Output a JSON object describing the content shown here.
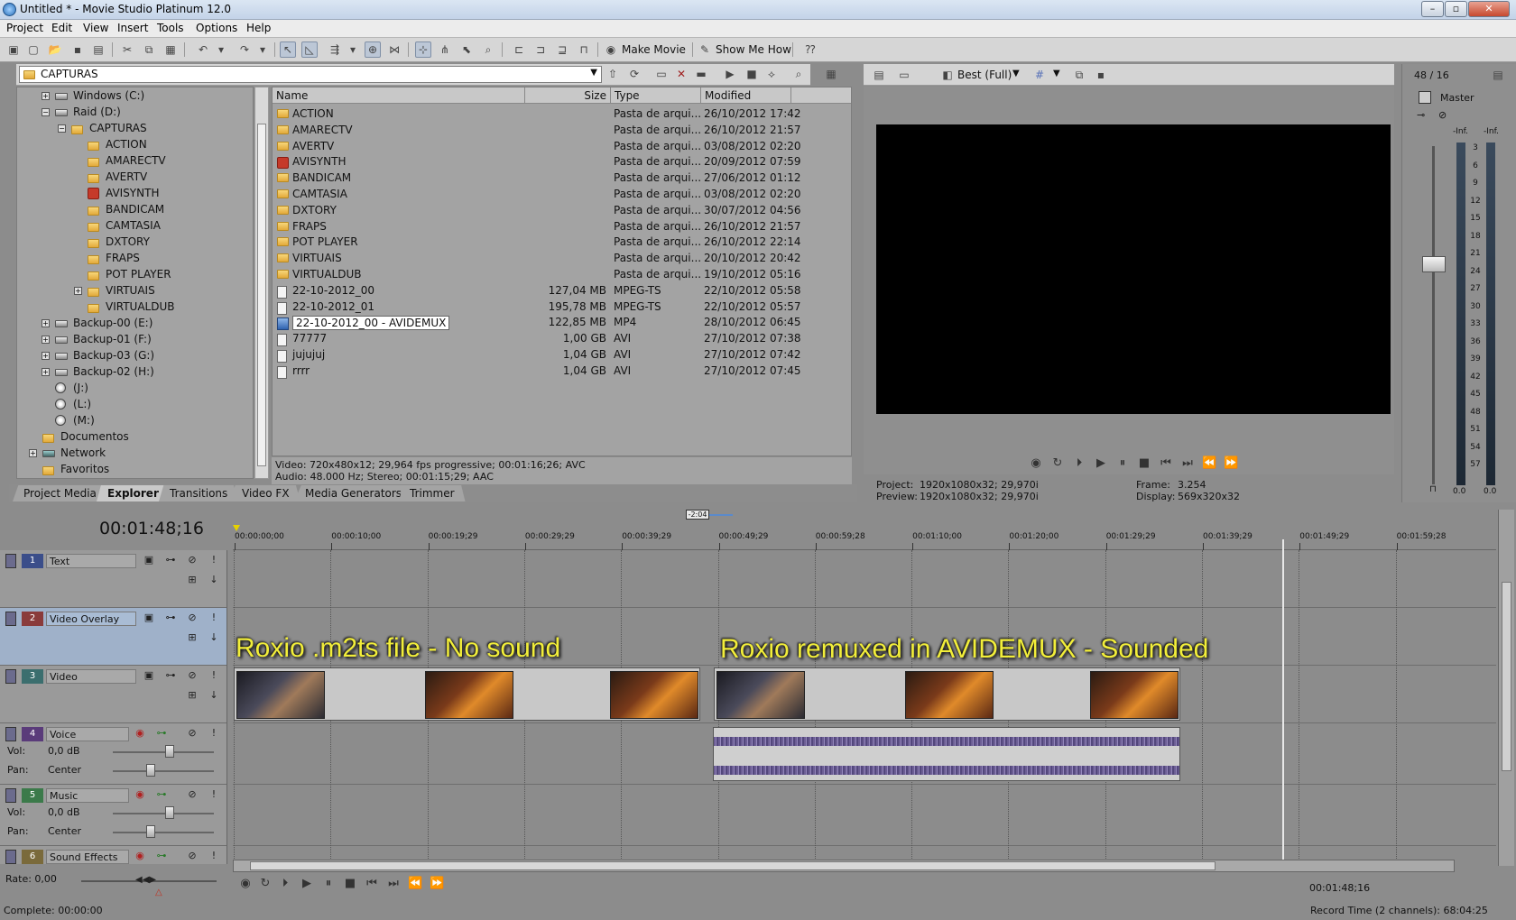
{
  "window": {
    "title": "Untitled * - Movie Studio Platinum 12.0",
    "controls": [
      "–",
      "▫",
      "✕"
    ]
  },
  "menu": [
    "Project",
    "Edit",
    "View",
    "Insert",
    "Tools",
    "Options",
    "Help"
  ],
  "toolbar": {
    "make_movie": "Make Movie",
    "show_me_how": "Show Me How"
  },
  "explorer": {
    "path": "CAPTURAS",
    "tree": [
      {
        "label": "Windows (C:)",
        "indent": 0,
        "icon": "drive",
        "expander": "+"
      },
      {
        "label": "Raid (D:)",
        "indent": 0,
        "icon": "drive",
        "expander": "−"
      },
      {
        "label": "CAPTURAS",
        "indent": 1,
        "icon": "folder",
        "expander": "−"
      },
      {
        "label": "ACTION",
        "indent": 2,
        "icon": "folder",
        "expander": ""
      },
      {
        "label": "AMARECTV",
        "indent": 2,
        "icon": "folder",
        "expander": ""
      },
      {
        "label": "AVERTV",
        "indent": 2,
        "icon": "folder",
        "expander": ""
      },
      {
        "label": "AVISYNTH",
        "indent": 2,
        "icon": "red",
        "expander": ""
      },
      {
        "label": "BANDICAM",
        "indent": 2,
        "icon": "folder",
        "expander": ""
      },
      {
        "label": "CAMTASIA",
        "indent": 2,
        "icon": "folder",
        "expander": ""
      },
      {
        "label": "DXTORY",
        "indent": 2,
        "icon": "folder",
        "expander": ""
      },
      {
        "label": "FRAPS",
        "indent": 2,
        "icon": "folder",
        "expander": ""
      },
      {
        "label": "POT PLAYER",
        "indent": 2,
        "icon": "folder",
        "expander": ""
      },
      {
        "label": "VIRTUAIS",
        "indent": 2,
        "icon": "folder",
        "expander": "+"
      },
      {
        "label": "VIRTUALDUB",
        "indent": 2,
        "icon": "folder",
        "expander": ""
      },
      {
        "label": "Backup-00 (E:)",
        "indent": 0,
        "icon": "drive",
        "expander": "+"
      },
      {
        "label": "Backup-01 (F:)",
        "indent": 0,
        "icon": "drive",
        "expander": "+"
      },
      {
        "label": "Backup-03 (G:)",
        "indent": 0,
        "icon": "drive",
        "expander": "+"
      },
      {
        "label": "Backup-02 (H:)",
        "indent": 0,
        "icon": "drive",
        "expander": "+"
      },
      {
        "label": "(J:)",
        "indent": 0,
        "icon": "cd",
        "expander": ""
      },
      {
        "label": "(L:)",
        "indent": 0,
        "icon": "cd",
        "expander": ""
      },
      {
        "label": "(M:)",
        "indent": 0,
        "icon": "cd",
        "expander": ""
      },
      {
        "label": "Documentos",
        "indent": -1,
        "icon": "folder",
        "expander": ""
      },
      {
        "label": "Network",
        "indent": -1,
        "icon": "net",
        "expander": "+"
      },
      {
        "label": "Favoritos",
        "indent": -1,
        "icon": "folder",
        "expander": ""
      }
    ],
    "columns": [
      "Name",
      "Size",
      "Type",
      "Modified"
    ],
    "files": [
      {
        "name": "ACTION",
        "size": "",
        "type": "Pasta de arqui...",
        "modified": "26/10/2012 17:42",
        "icon": "folder"
      },
      {
        "name": "AMARECTV",
        "size": "",
        "type": "Pasta de arqui...",
        "modified": "26/10/2012 21:57",
        "icon": "folder"
      },
      {
        "name": "AVERTV",
        "size": "",
        "type": "Pasta de arqui...",
        "modified": "03/08/2012 02:20",
        "icon": "folder"
      },
      {
        "name": "AVISYNTH",
        "size": "",
        "type": "Pasta de arqui...",
        "modified": "20/09/2012 07:59",
        "icon": "red"
      },
      {
        "name": "BANDICAM",
        "size": "",
        "type": "Pasta de arqui...",
        "modified": "27/06/2012 01:12",
        "icon": "folder"
      },
      {
        "name": "CAMTASIA",
        "size": "",
        "type": "Pasta de arqui...",
        "modified": "03/08/2012 02:20",
        "icon": "folder"
      },
      {
        "name": "DXTORY",
        "size": "",
        "type": "Pasta de arqui...",
        "modified": "30/07/2012 04:56",
        "icon": "folder"
      },
      {
        "name": "FRAPS",
        "size": "",
        "type": "Pasta de arqui...",
        "modified": "26/10/2012 21:57",
        "icon": "folder"
      },
      {
        "name": "POT PLAYER",
        "size": "",
        "type": "Pasta de arqui...",
        "modified": "26/10/2012 22:14",
        "icon": "folder"
      },
      {
        "name": "VIRTUAIS",
        "size": "",
        "type": "Pasta de arqui...",
        "modified": "20/10/2012 20:42",
        "icon": "folder"
      },
      {
        "name": "VIRTUALDUB",
        "size": "",
        "type": "Pasta de arqui...",
        "modified": "19/10/2012 05:16",
        "icon": "folder"
      },
      {
        "name": "22-10-2012_00",
        "size": "127,04 MB",
        "type": "MPEG-TS",
        "modified": "22/10/2012 05:58",
        "icon": "doc"
      },
      {
        "name": "22-10-2012_01",
        "size": "195,78 MB",
        "type": "MPEG-TS",
        "modified": "22/10/2012 05:57",
        "icon": "doc"
      },
      {
        "name": "22-10-2012_00 - AVIDEMUX",
        "size": "122,85 MB",
        "type": "MP4",
        "modified": "28/10/2012 06:45",
        "icon": "mp4",
        "selected": true
      },
      {
        "name": "77777",
        "size": "1,00 GB",
        "type": "AVI",
        "modified": "27/10/2012 07:38",
        "icon": "doc"
      },
      {
        "name": "jujujuj",
        "size": "1,04 GB",
        "type": "AVI",
        "modified": "27/10/2012 07:42",
        "icon": "doc"
      },
      {
        "name": "rrrr",
        "size": "1,04 GB",
        "type": "AVI",
        "modified": "27/10/2012 07:45",
        "icon": "doc"
      }
    ],
    "info_line1": "Video: 720x480x12; 29,964 fps progressive; 00:01:16;26; AVC",
    "info_line2": "Audio: 48.000 Hz; Stereo; 00:01:15;29; AAC"
  },
  "tabs": [
    "Project Media",
    "Explorer",
    "Transitions",
    "Video FX",
    "Media Generators",
    "Trimmer"
  ],
  "active_tab": "Explorer",
  "preview": {
    "quality": "Best (Full)",
    "project_label": "Project:",
    "project_value": "1920x1080x32; 29,970i",
    "preview_label": "Preview:",
    "preview_value": "1920x1080x32; 29,970i",
    "frame_label": "Frame:",
    "frame_value": "3.254",
    "display_label": "Display:",
    "display_value": "569x320x32"
  },
  "mixer": {
    "header": "48 / 16",
    "master": "Master",
    "inf_left": "-Inf.",
    "inf_right": "-Inf.",
    "scale": [
      "3",
      "6",
      "9",
      "12",
      "15",
      "18",
      "21",
      "24",
      "27",
      "30",
      "33",
      "36",
      "39",
      "42",
      "45",
      "48",
      "51",
      "54",
      "57"
    ],
    "bottom_left": "0.0",
    "bottom_right": "0.0"
  },
  "timeline": {
    "timecode": "00:01:48;16",
    "marker": "-2:04",
    "ruler": [
      "00:00:00;00",
      "00:00:10;00",
      "00:00:19;29",
      "00:00:29;29",
      "00:00:39;29",
      "00:00:49;29",
      "00:00:59;28",
      "00:01:10;00",
      "00:01:20;00",
      "00:01:29;29",
      "00:01:39;29",
      "00:01:49;29",
      "00:01:59;28"
    ],
    "tracks": [
      {
        "num": "1",
        "name": "Text",
        "color": "#3b4e8a"
      },
      {
        "num": "2",
        "name": "Video Overlay",
        "color": "#8a3b3b"
      },
      {
        "num": "3",
        "name": "Video",
        "color": "#3b6e6e"
      },
      {
        "num": "4",
        "name": "Voice",
        "color": "#5a3b7a"
      },
      {
        "num": "5",
        "name": "Music",
        "color": "#3b7a4a"
      },
      {
        "num": "6",
        "name": "Sound Effects",
        "color": "#7a6a3b"
      }
    ],
    "voice": {
      "vol_label": "Vol:",
      "vol_value": "0,0 dB",
      "pan_label": "Pan:",
      "pan_value": "Center"
    },
    "music": {
      "vol_label": "Vol:",
      "vol_value": "0,0 dB",
      "pan_label": "Pan:",
      "pan_value": "Center"
    },
    "overlay_left": "Roxio .m2ts file - No sound",
    "overlay_right": "Roxio remuxed in AVIDEMUX - Sounded",
    "rate": "Rate: 0,00",
    "position_time": "00:01:48;16"
  },
  "status": {
    "complete": "Complete: 00:00:00",
    "record_time": "Record Time (2 channels): 68:04:25"
  }
}
